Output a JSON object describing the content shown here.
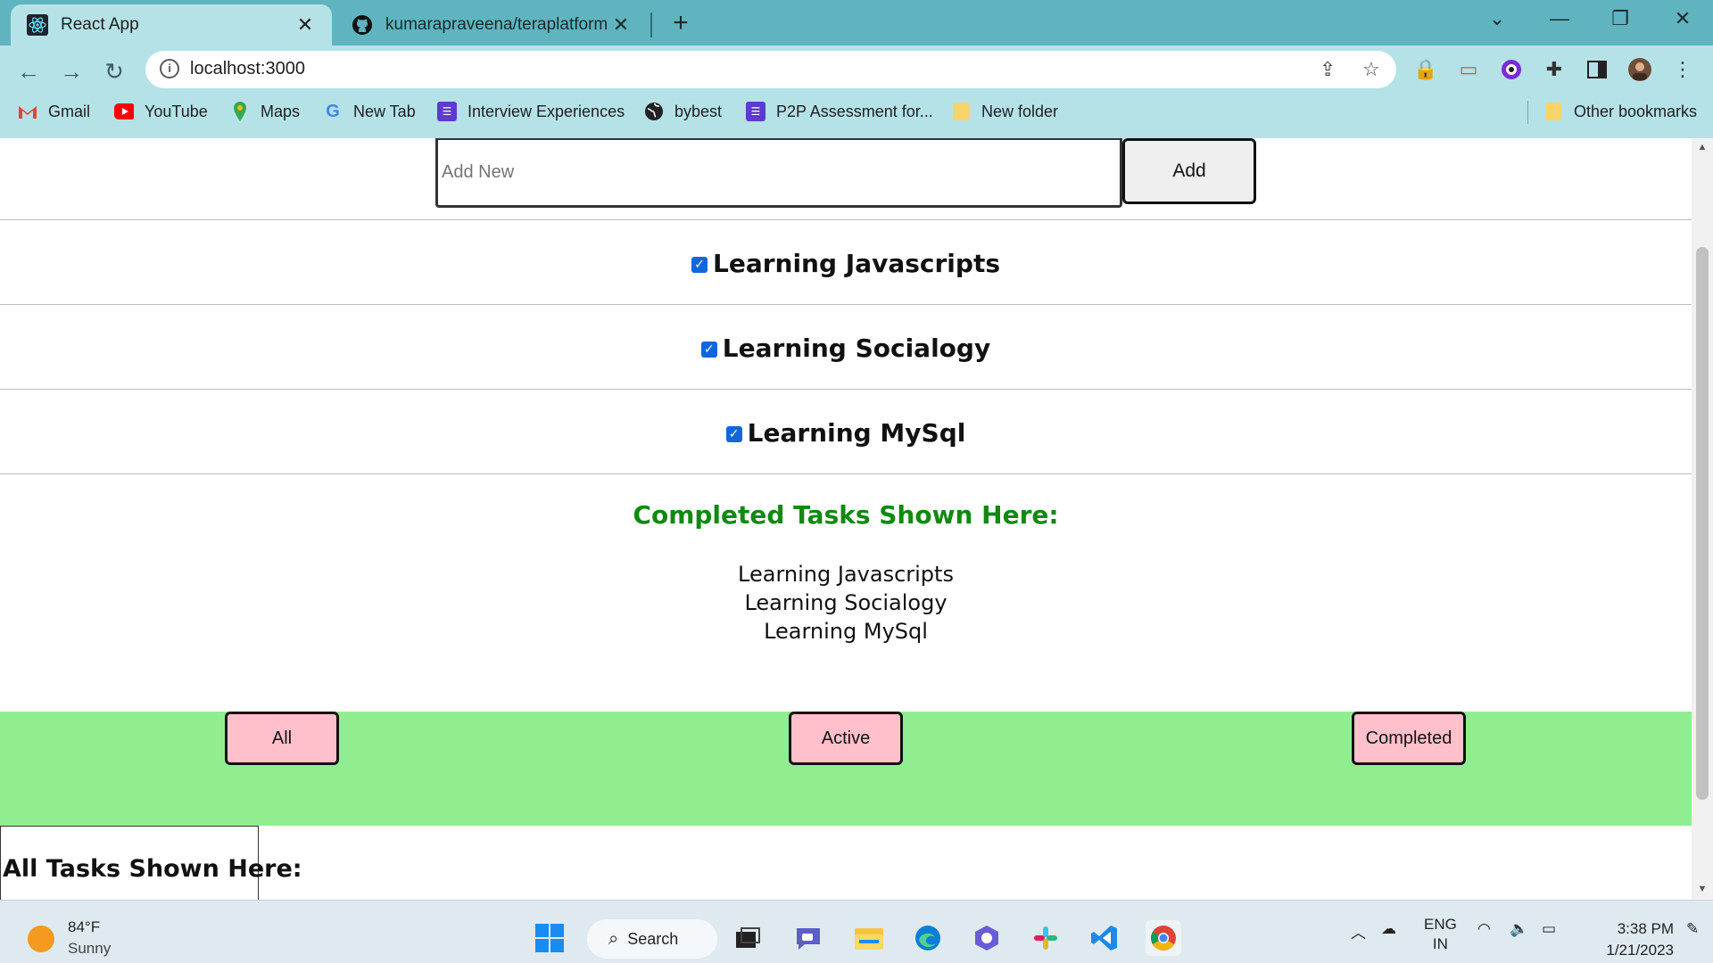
{
  "browser": {
    "tabs": [
      {
        "title": "React App",
        "active": true
      },
      {
        "title": "kumarapraveena/teraplatform",
        "active": false
      }
    ],
    "url": "localhost:3000",
    "bookmarks": [
      "Gmail",
      "YouTube",
      "Maps",
      "New Tab",
      "Interview Experiences",
      "bybest",
      "P2P Assessment for...",
      "New folder"
    ],
    "other_bookmarks": "Other bookmarks"
  },
  "app": {
    "input_placeholder": "Add New",
    "add_label": "Add",
    "tasks": [
      {
        "label": "Learning Javascripts",
        "checked": true
      },
      {
        "label": "Learning Socialogy",
        "checked": true
      },
      {
        "label": "Learning MySql",
        "checked": true
      }
    ],
    "completed_title": "Completed Tasks Shown Here:",
    "completed": [
      "Learning Javascripts",
      "Learning Socialogy",
      "Learning MySql"
    ],
    "filters": [
      "All",
      "Active",
      "Completed"
    ],
    "all_title": "All Tasks Shown Here:",
    "colors": {
      "filter_bar": "#90ee90",
      "filter_button": "#ffc0cb",
      "completed_title": "#0f8a0f"
    }
  },
  "taskbar": {
    "temperature": "84°F",
    "condition": "Sunny",
    "search_label": "Search",
    "language": "ENG",
    "region": "IN",
    "time": "3:38 PM",
    "date": "1/21/2023"
  }
}
